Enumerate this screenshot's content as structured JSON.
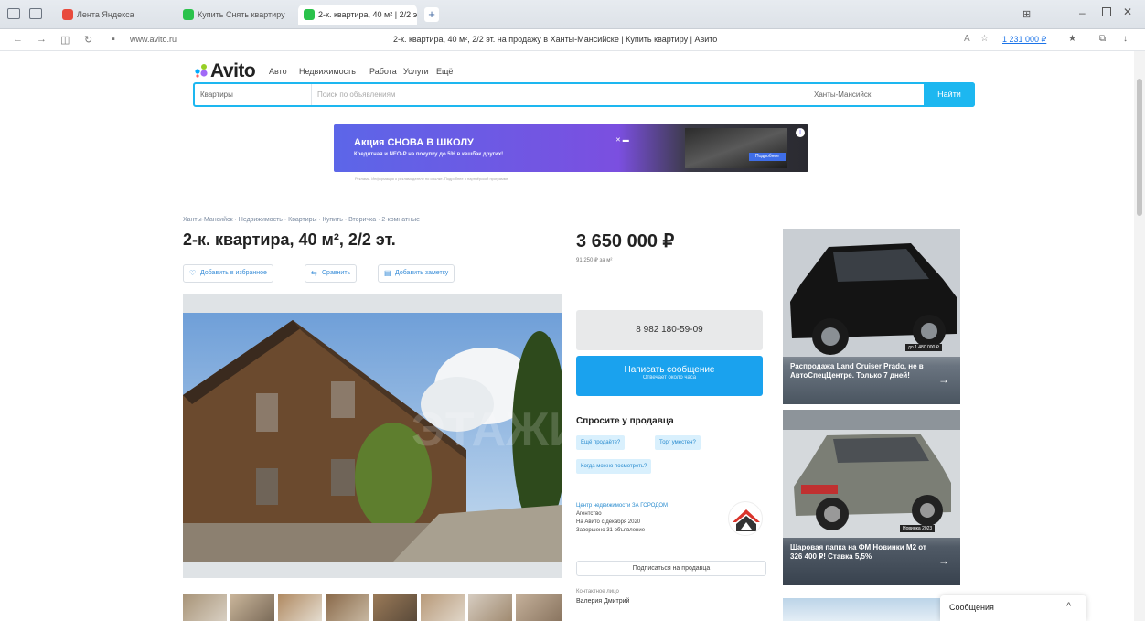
{
  "browser": {
    "tabs": [
      {
        "label": "Лента Яндекса"
      },
      {
        "label": "Купить Снять квартиру"
      },
      {
        "label": "2-к. квартира, 40 м² | 2/2 эт."
      }
    ],
    "url": "www.avito.ru",
    "page_title": "2-к. квартира, 40 м², 2/2 эт. на продажу в Ханты-Мансийске | Купить квартиру | Авито",
    "right_label": "1 231 000 ₽"
  },
  "site": {
    "logo": "Avito",
    "nav": [
      "Авто",
      "Недвижимость",
      "Работа",
      "Услуги",
      "Ещё"
    ],
    "search": {
      "category": "Квартиры",
      "placeholder": "Поиск по объявлениям",
      "location": "Ханты-Мансийск",
      "button": "Найти"
    }
  },
  "banner": {
    "title": "Акция СНОВА В ШКОЛУ",
    "text": "Кредитная и NEO-Р на покупку до 5% в кешбэк других!",
    "button": "Подробнее",
    "disclaimer": "Реклама. Информация о рекламодателе по ссылке. Подробнее о партнёрской программе"
  },
  "listing": {
    "breadcrumbs": "Ханты-Мансийск · Недвижимость · Квартиры · Купить · Вторичка · 2-комнатные",
    "title": "2-к. квартира, 40 м², 2/2 эт.",
    "actions": [
      "Добавить в избранное",
      "Сравнить",
      "Добавить заметку"
    ],
    "price": "3 650 000 ₽",
    "price_per_m": "91 250 ₽ за м²",
    "phone": "8 982 180-59-09",
    "message_button": "Написать сообщение",
    "message_sub": "Отвечает около часа",
    "ask_title": "Спросите у продавца",
    "questions": [
      "Ещё продаёте?",
      "Торг уместен?",
      "Когда можно посмотреть?"
    ],
    "seller": {
      "name": "Центр недвижимости ЗА ГОРОДОМ",
      "type": "Агентство",
      "since": "На Авито с декабря 2020",
      "completed": "Завершено 31 объявление"
    },
    "subscribe": "Подписаться на продавца",
    "contact_label": "Контактное лицо",
    "contact_name": "Валерия Дмитрий",
    "watermark": "ЭТАЖИ"
  },
  "ads": [
    {
      "title": "Распродажа Land Cruiser Prado, не в АвтоСпецЦентре. Только 7 дней!",
      "badge": "до 1 480 000 ₽"
    },
    {
      "title": "Шаровая папка на ФМ Новинки M2 от 326 400 ₽! Ставка 5,5%",
      "badge": "Новинка 2023"
    }
  ],
  "chat": {
    "label": "Сообщения"
  },
  "colors": {
    "accent": "#1db7f0",
    "message_button": "#1aa2ee",
    "chip_bg": "#d9f0fd"
  }
}
